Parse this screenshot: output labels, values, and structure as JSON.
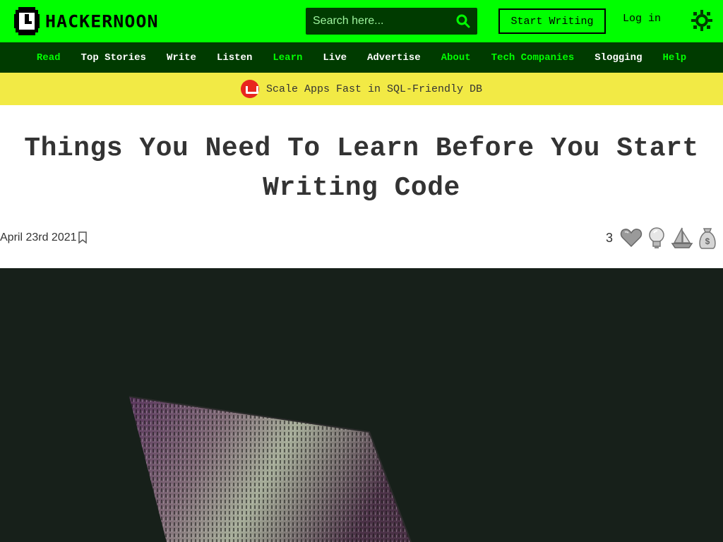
{
  "header": {
    "logo_text": "HACKERNOON",
    "search_placeholder": "Search here...",
    "start_writing_label": "Start Writing",
    "login_label": "Log in"
  },
  "nav": {
    "items": [
      {
        "label": "Read",
        "highlight": true
      },
      {
        "label": "Top Stories",
        "highlight": false
      },
      {
        "label": "Write",
        "highlight": false
      },
      {
        "label": "Listen",
        "highlight": false
      },
      {
        "label": "Learn",
        "highlight": true
      },
      {
        "label": "Live",
        "highlight": false
      },
      {
        "label": "Advertise",
        "highlight": false
      },
      {
        "label": "About",
        "highlight": true
      },
      {
        "label": "Tech Companies",
        "highlight": true
      },
      {
        "label": "Slogging",
        "highlight": false
      },
      {
        "label": "Help",
        "highlight": true
      }
    ]
  },
  "sponsor": {
    "text": "Scale Apps Fast in SQL-Friendly DB"
  },
  "article": {
    "title": "Things You Need To Learn Before You Start Writing Code",
    "date": "April 23rd 2021",
    "reaction_count": "3"
  },
  "icons": {
    "search": "search-icon",
    "theme": "sun-icon",
    "bookmark": "bookmark-icon",
    "reactions": [
      "heart-icon",
      "lightbulb-icon",
      "boat-icon",
      "money-bag-icon"
    ]
  },
  "colors": {
    "brand_green": "#00ff00",
    "dark_green": "#003b00",
    "sponsor_yellow": "#f2ea45",
    "text": "#333333",
    "hero_bg": "#17201a"
  }
}
